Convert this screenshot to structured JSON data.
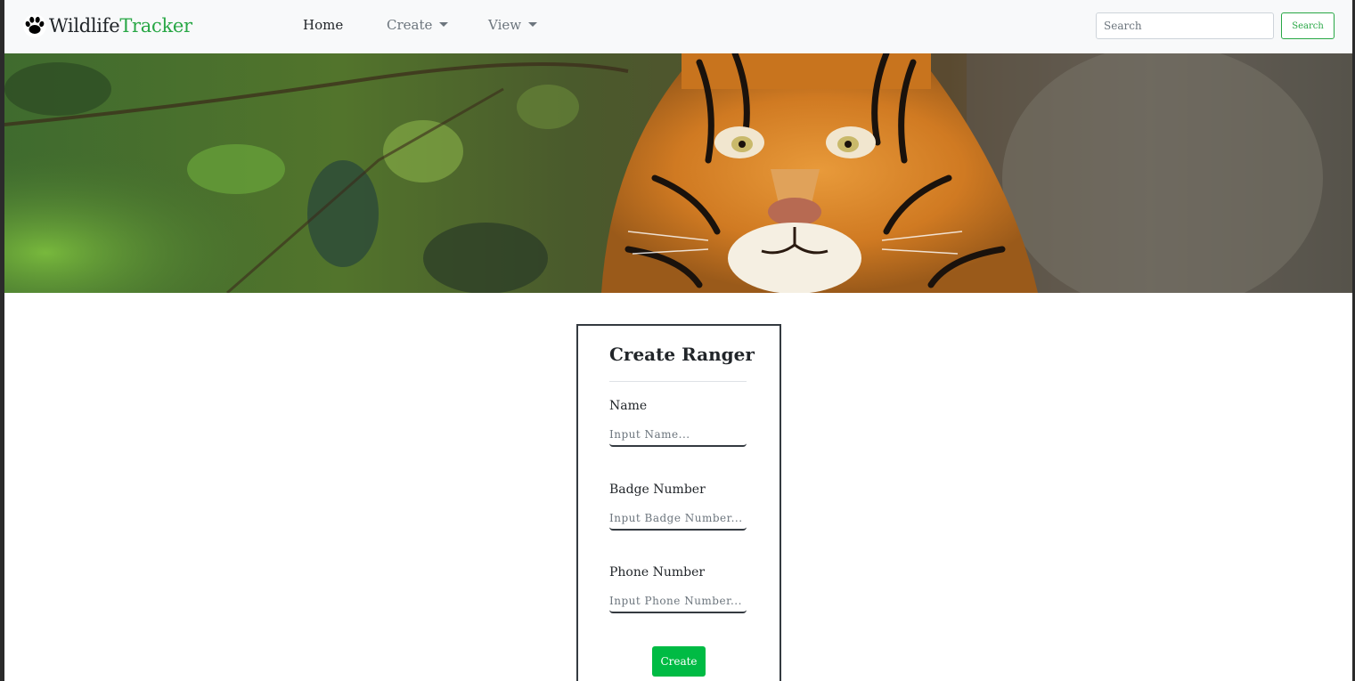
{
  "navbar": {
    "brand_part1": "Wildlife",
    "brand_part2": "Tracker",
    "logo_icon": "paw-icon",
    "links": [
      {
        "label": "Home",
        "active": true
      },
      {
        "label": "Create",
        "dropdown": true
      },
      {
        "label": "View",
        "dropdown": true
      }
    ],
    "search": {
      "placeholder": "Search",
      "button_label": "Search"
    }
  },
  "hero": {
    "image": "tiger in jungle foliage banner"
  },
  "form": {
    "title": "Create Ranger",
    "fields": [
      {
        "label": "Name",
        "placeholder": "Input Name..."
      },
      {
        "label": "Badge Number",
        "placeholder": "Input Badge Number..."
      },
      {
        "label": "Phone Number",
        "placeholder": "Input Phone Number..."
      }
    ],
    "submit_label": "Create"
  },
  "colors": {
    "brand_green": "#28a745",
    "button_green": "#00bb44",
    "navbar_bg": "#f8f9fa"
  }
}
